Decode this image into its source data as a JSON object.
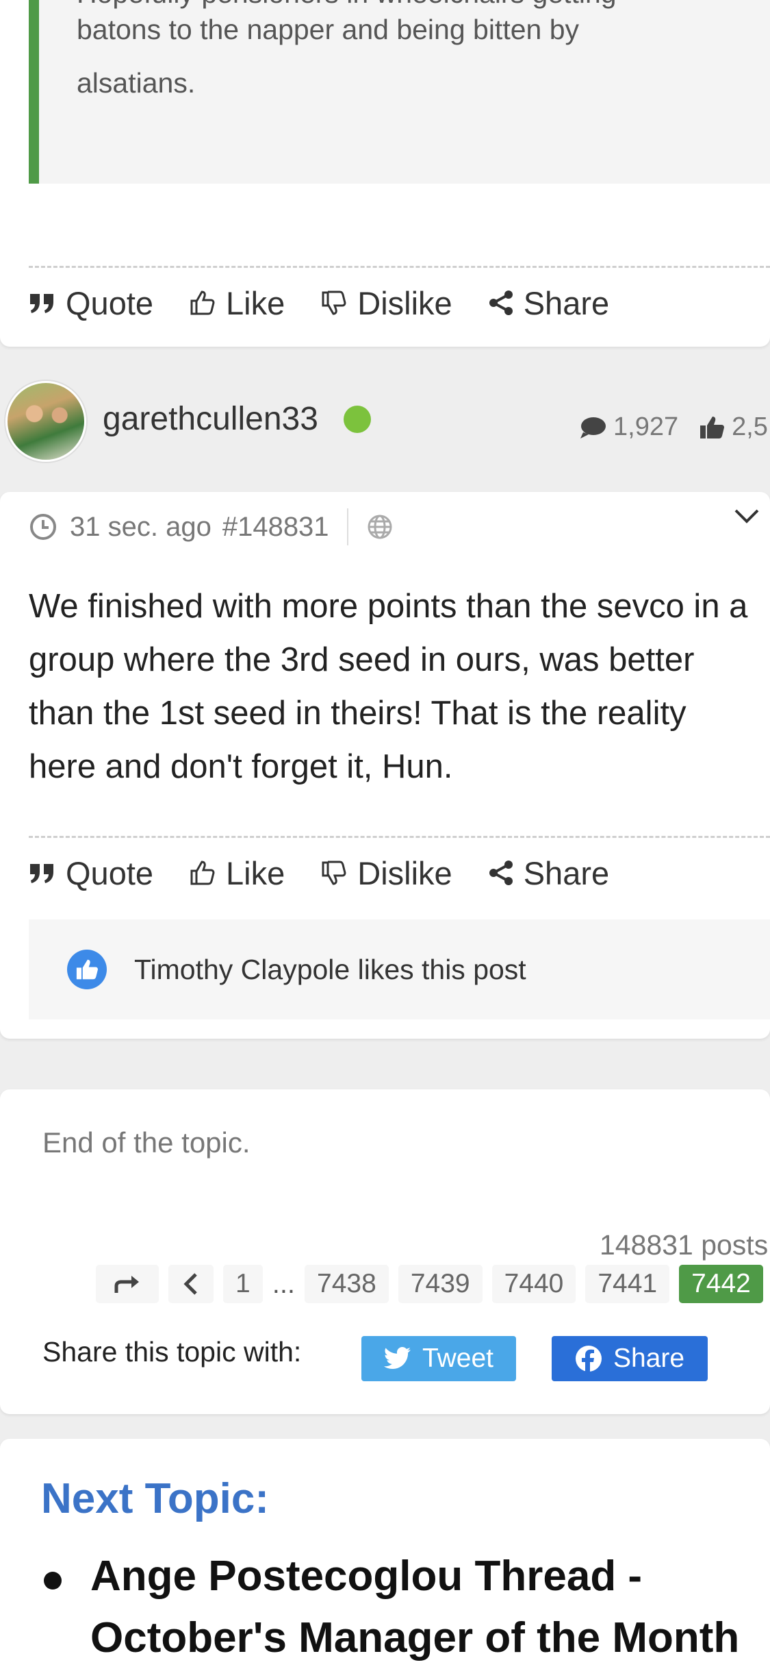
{
  "quote": {
    "cut_line": "Hopefully pensioners in wheelchairs getting",
    "line1": "batons to the napper and being bitten by",
    "line2": "alsatians."
  },
  "actions": {
    "quote": "Quote",
    "like": "Like",
    "dislike": "Dislike",
    "share": "Share"
  },
  "author": {
    "username": "garethcullen33",
    "post_count": "1,927",
    "likes_count": "2,5"
  },
  "post": {
    "time": "31 sec. ago",
    "number": "#148831",
    "body": "We finished with more points than the sevco in a group where the 3rd seed in ours, was better than the 1st seed in theirs! That is the reality here and don't forget it, Hun.",
    "liked_by": "Timothy Claypole likes this post"
  },
  "topic_end": {
    "end_text": "End of the topic.",
    "posts_total": "148831 posts",
    "pages": [
      "1",
      "...",
      "7438",
      "7439",
      "7440",
      "7441",
      "7442"
    ],
    "current_page": "7442",
    "share_label": "Share this topic with:",
    "tweet_label": "Tweet",
    "fb_label": "Share"
  },
  "next_topic": {
    "label": "Next Topic:",
    "title": "Ange Postecoglou Thread - October's Manager of the Month"
  },
  "colors": {
    "accent_green": "#4f9a47",
    "online_green": "#7cc23d",
    "link_blue": "#3b73c7",
    "twitter_blue": "#4aa7e8",
    "facebook_blue": "#2a6fd8"
  }
}
